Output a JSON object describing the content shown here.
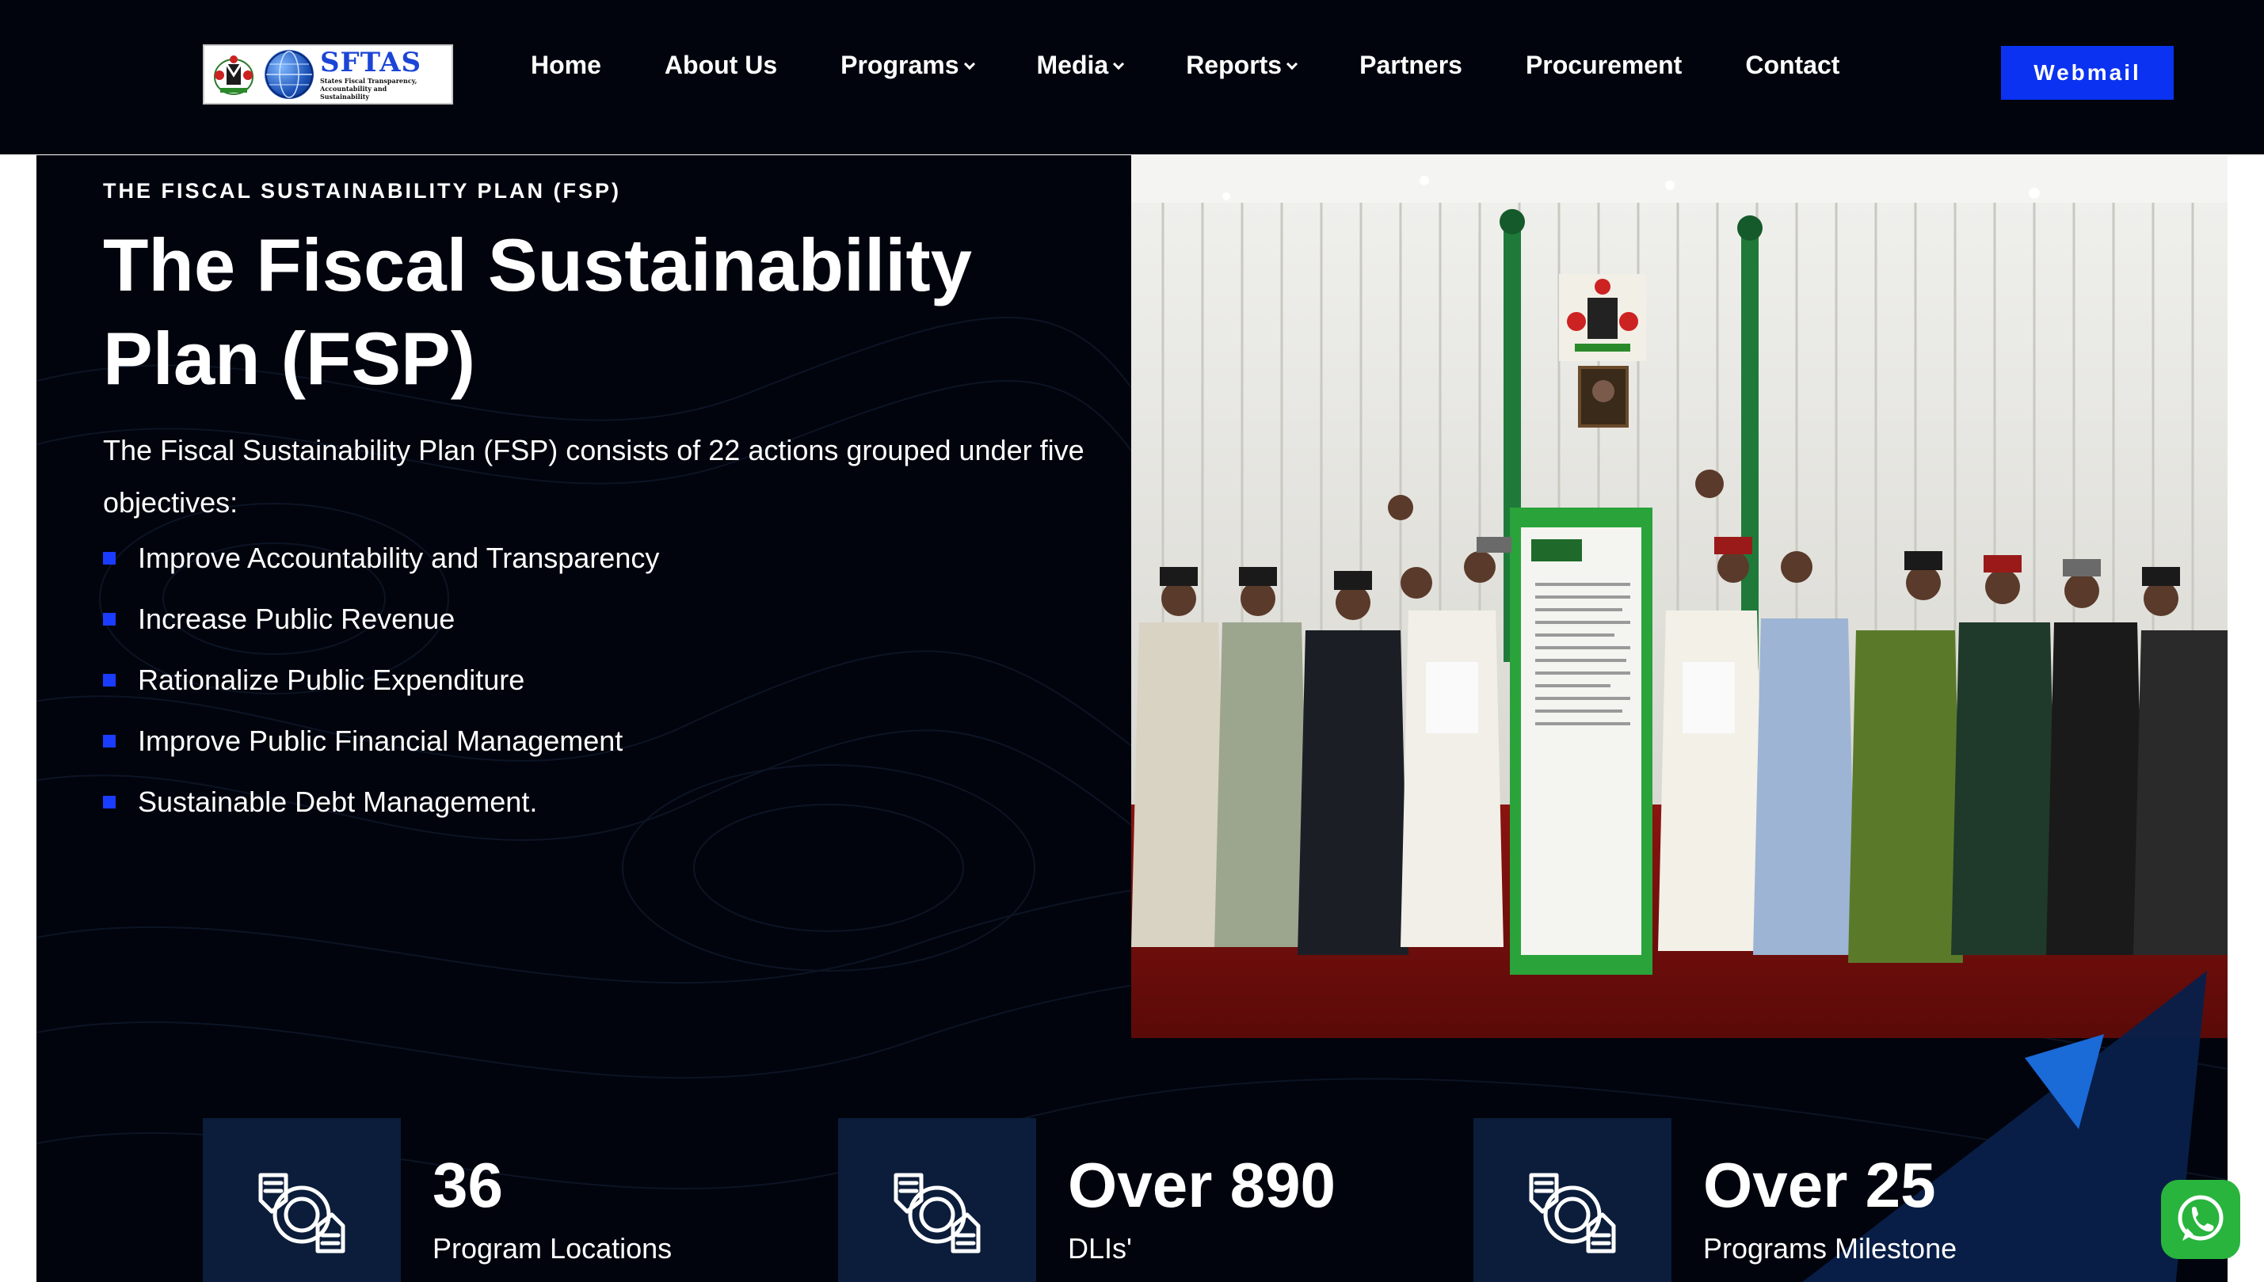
{
  "header": {
    "logo": {
      "title": "SFTAS",
      "subtitle_lines": [
        "States Fiscal Transparency,",
        "Accountability and",
        "Sustainability"
      ]
    },
    "nav": [
      {
        "label": "Home",
        "has_dropdown": false
      },
      {
        "label": "About Us",
        "has_dropdown": false
      },
      {
        "label": "Programs",
        "has_dropdown": true
      },
      {
        "label": "Media",
        "has_dropdown": true
      },
      {
        "label": "Reports",
        "has_dropdown": true
      },
      {
        "label": "Partners",
        "has_dropdown": false
      },
      {
        "label": "Procurement",
        "has_dropdown": false
      },
      {
        "label": "Contact",
        "has_dropdown": false
      }
    ],
    "webmail_label": "Webmail"
  },
  "hero": {
    "kicker": "THE FISCAL SUSTAINABILITY PLAN (FSP)",
    "title": "The Fiscal Sustainability Plan (FSP)",
    "intro": "The Fiscal Sustainability Plan (FSP) consists of 22 actions grouped under five objectives:",
    "objectives": [
      "Improve Accountability and Transparency",
      "Increase Public Revenue",
      "Rationalize Public Expenditure",
      "Improve Public Financial Management",
      "Sustainable Debt Management."
    ]
  },
  "stats": [
    {
      "value": "36",
      "label": "Program Locations",
      "icon": "hands-cycle-icon"
    },
    {
      "value": "Over 890",
      "label": "DLIs'",
      "icon": "hands-cycle-icon"
    },
    {
      "value": "Over 25",
      "label": "Programs Milestone",
      "icon": "hands-cycle-icon"
    }
  ],
  "colors": {
    "background": "#01040d",
    "accent_blue": "#0a32f0",
    "bullet_blue": "#1a3cff",
    "stat_box": "#0b1d3a",
    "whatsapp_green": "#29b43e"
  },
  "floating": {
    "whatsapp_icon": "whatsapp-icon"
  }
}
